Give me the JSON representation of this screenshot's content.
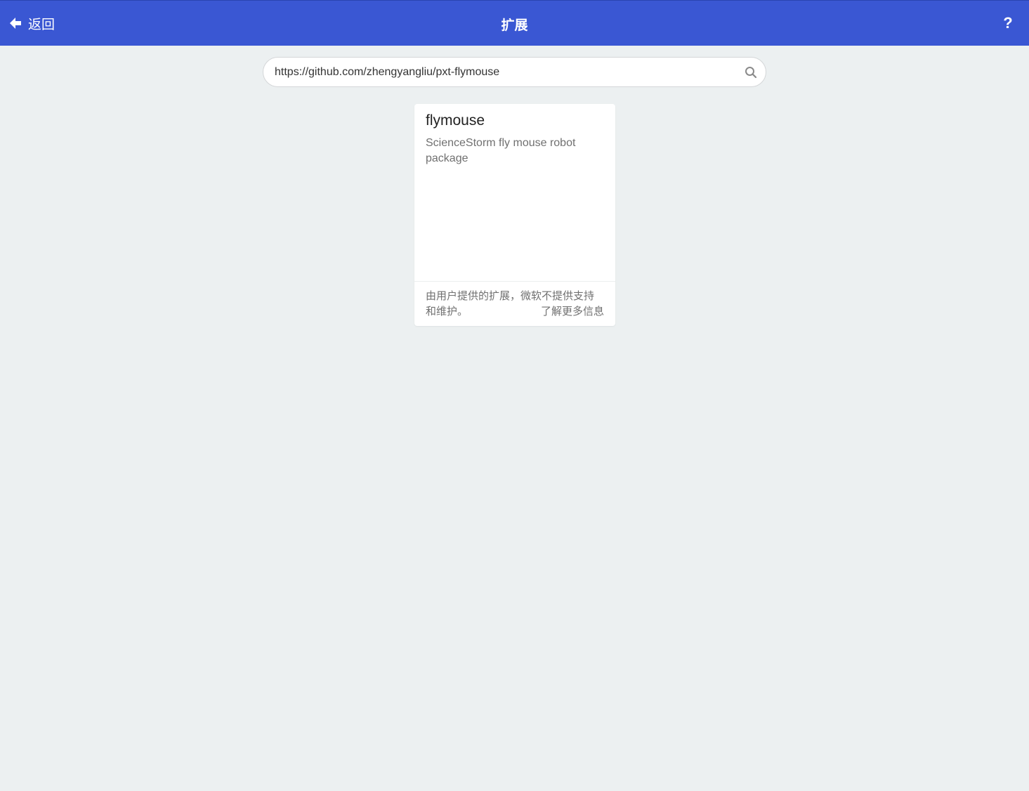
{
  "header": {
    "back_label": "返回",
    "title": "扩展",
    "help_label": "?"
  },
  "search": {
    "value": "https://github.com/zhengyangliu/pxt-flymouse",
    "icon": "search-icon"
  },
  "results": [
    {
      "title": "flymouse",
      "description": "ScienceStorm fly mouse robot package",
      "disclaimer": "由用户提供的扩展，微软不提供支持和维护。",
      "learn_more": "了解更多信息"
    }
  ],
  "colors": {
    "header_bg": "#3A57D3",
    "page_bg": "#ECF0F1",
    "card_bg": "#FFFFFF"
  }
}
